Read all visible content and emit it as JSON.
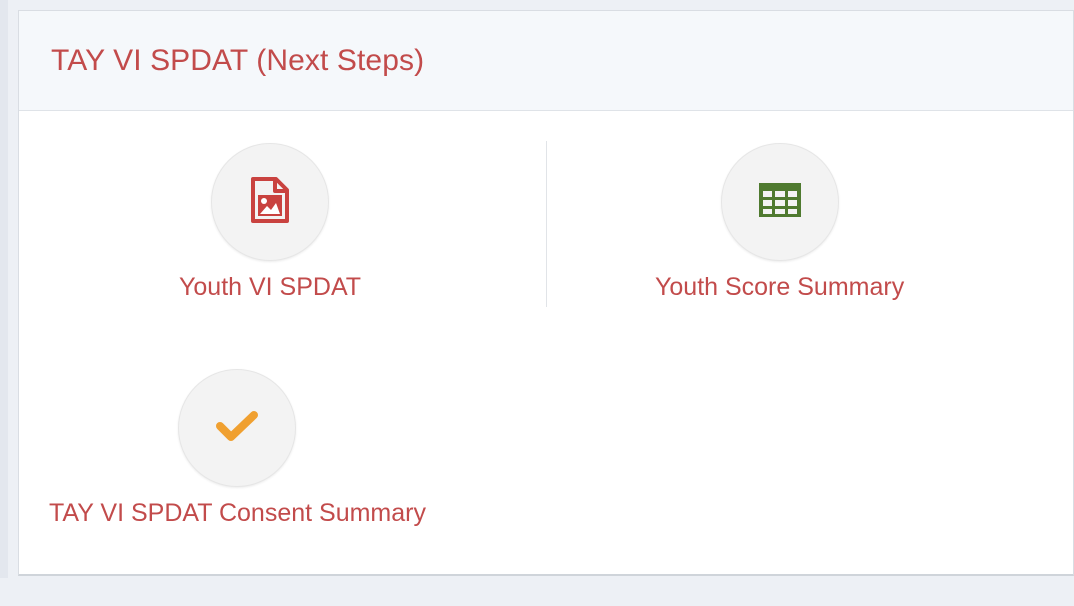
{
  "panel": {
    "title": "TAY VI SPDAT (Next Steps)"
  },
  "tiles": [
    {
      "label": "Youth VI SPDAT",
      "icon": "image-file-icon",
      "icon_color": "#c9423f"
    },
    {
      "label": "Youth Score Summary",
      "icon": "table-icon",
      "icon_color": "#4f7a2f"
    },
    {
      "label": "TAY VI SPDAT Consent Summary",
      "icon": "checkmark-icon",
      "icon_color": "#f0a030"
    }
  ],
  "colors": {
    "accent_text": "#c24b4b",
    "header_bg": "#f5f8fb",
    "page_bg": "#edf0f5"
  }
}
